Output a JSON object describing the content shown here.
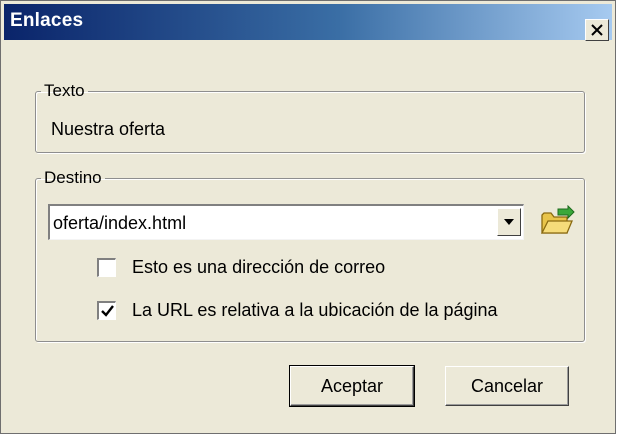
{
  "window": {
    "title": "Enlaces",
    "close_icon": "close-icon"
  },
  "texto_group": {
    "legend": "Texto",
    "value": "Nuestra oferta"
  },
  "destino_group": {
    "legend": "Destino",
    "url_value": "oferta/index.html",
    "dropdown_icon": "chevron-down-icon",
    "browse_icon": "folder-open-icon",
    "checkboxes": [
      {
        "label": "Esto es una dirección de correo",
        "checked": false
      },
      {
        "label": "La URL es relativa a la ubicación de la página",
        "checked": true
      }
    ]
  },
  "buttons": {
    "ok_label": "Aceptar",
    "cancel_label": "Cancelar"
  },
  "colors": {
    "titlebar_start": "#0a246a",
    "titlebar_end": "#a6caf0",
    "dialog_bg": "#ece9d8"
  }
}
